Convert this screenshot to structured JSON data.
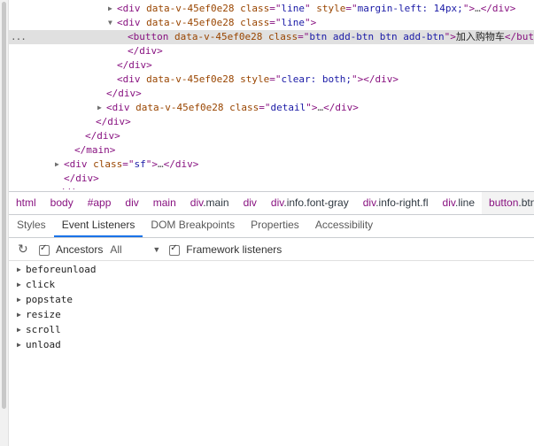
{
  "dom_tree": {
    "lines": [
      {
        "ind": 0,
        "tri": "▶",
        "open": "<div",
        "attrs": [
          {
            "n": "data-v-45ef0e28",
            "v": null
          },
          {
            "n": "class",
            "v": "line"
          },
          {
            "n": "style",
            "v": "margin-left: 14px;"
          }
        ],
        "close": ">…</div>"
      },
      {
        "ind": 0,
        "tri": "▼",
        "open": "<div",
        "attrs": [
          {
            "n": "data-v-45ef0e28",
            "v": null
          },
          {
            "n": "class",
            "v": "line"
          }
        ],
        "close": ">"
      },
      {
        "ind": 1,
        "tri": "",
        "open": "<button",
        "attrs": [
          {
            "n": "data-v-45ef0e28",
            "v": null
          },
          {
            "n": "class",
            "v": "btn add-btn btn add-btn"
          }
        ],
        "close": ">",
        "text": "加入购物车",
        "end": "</button>",
        "selected": true
      },
      {
        "ind": 1,
        "tri": "",
        "open": "</div>",
        "attrs": [],
        "close": ""
      },
      {
        "ind": 0,
        "tri": "",
        "open": "</div>",
        "attrs": [],
        "close": ""
      },
      {
        "ind": 0,
        "tri": "",
        "open": "<div",
        "attrs": [
          {
            "n": "data-v-45ef0e28",
            "v": null
          },
          {
            "n": "style",
            "v": "clear: both;"
          }
        ],
        "close": "></div>"
      },
      {
        "ind": -1,
        "tri": "",
        "open": "</div>",
        "attrs": [],
        "close": ""
      },
      {
        "ind": -1,
        "tri": "▶",
        "open": "<div",
        "attrs": [
          {
            "n": "data-v-45ef0e28",
            "v": null
          },
          {
            "n": "class",
            "v": "detail"
          }
        ],
        "close": ">…</div>"
      },
      {
        "ind": -2,
        "tri": "",
        "open": "</div>",
        "attrs": [],
        "close": ""
      },
      {
        "ind": -3,
        "tri": "",
        "open": "</div>",
        "attrs": [],
        "close": ""
      },
      {
        "ind": -4,
        "tri": "",
        "open": "</main>",
        "attrs": [],
        "close": ""
      },
      {
        "ind": -5,
        "tri": "▶",
        "open": "<div",
        "attrs": [
          {
            "n": "class",
            "v": "sf"
          }
        ],
        "close": ">…</div>"
      },
      {
        "ind": -5,
        "tri": "",
        "open": "</div>",
        "attrs": [],
        "close": ""
      },
      {
        "ind": -6,
        "tri": "",
        "open": "</div>",
        "attrs": [],
        "close": ""
      }
    ],
    "selected_dots": "..."
  },
  "breadcrumbs": [
    "html",
    "body",
    "#app",
    "div",
    "main",
    "div.main",
    "div",
    "div.info.font-gray",
    "div.info-right.fl",
    "div.line",
    "button.btn.add"
  ],
  "tabs": [
    "Styles",
    "Event Listeners",
    "DOM Breakpoints",
    "Properties",
    "Accessibility"
  ],
  "active_tab": "Event Listeners",
  "toolbar": {
    "ancestors_label": "Ancestors",
    "filter_value": "All",
    "framework_label": "Framework listeners"
  },
  "listeners": [
    "beforeunload",
    "click",
    "popstate",
    "resize",
    "scroll",
    "unload"
  ],
  "icons": {
    "refresh": "refresh-icon",
    "expand": "triangle-right-icon",
    "collapse": "triangle-down-icon"
  }
}
